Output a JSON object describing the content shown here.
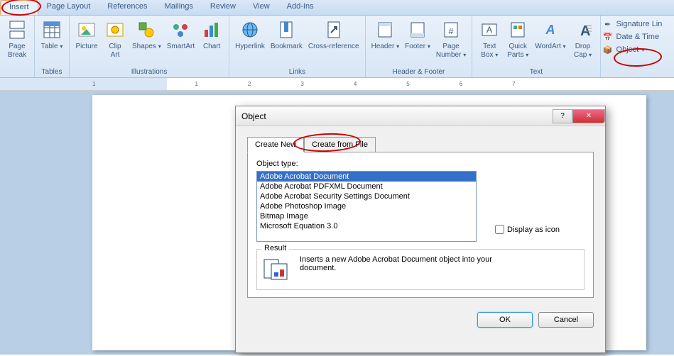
{
  "tabs": [
    "Insert",
    "Page Layout",
    "References",
    "Mailings",
    "Review",
    "View",
    "Add-Ins"
  ],
  "active_tab": "Insert",
  "ribbon": {
    "groups": [
      {
        "label": "",
        "items": [
          {
            "name": "page-break-button",
            "label": "Page\nBreak"
          }
        ]
      },
      {
        "label": "Tables",
        "items": [
          {
            "name": "table-button",
            "label": "Table",
            "dd": true
          }
        ]
      },
      {
        "label": "Illustrations",
        "items": [
          {
            "name": "picture-button",
            "label": "Picture"
          },
          {
            "name": "clipart-button",
            "label": "Clip\nArt"
          },
          {
            "name": "shapes-button",
            "label": "Shapes",
            "dd": true
          },
          {
            "name": "smartart-button",
            "label": "SmartArt"
          },
          {
            "name": "chart-button",
            "label": "Chart"
          }
        ]
      },
      {
        "label": "Links",
        "items": [
          {
            "name": "hyperlink-button",
            "label": "Hyperlink"
          },
          {
            "name": "bookmark-button",
            "label": "Bookmark"
          },
          {
            "name": "crossref-button",
            "label": "Cross-reference"
          }
        ]
      },
      {
        "label": "Header & Footer",
        "items": [
          {
            "name": "header-button",
            "label": "Header",
            "dd": true
          },
          {
            "name": "footer-button",
            "label": "Footer",
            "dd": true
          },
          {
            "name": "pagenum-button",
            "label": "Page\nNumber",
            "dd": true
          }
        ]
      },
      {
        "label": "Text",
        "items": [
          {
            "name": "textbox-button",
            "label": "Text\nBox",
            "dd": true
          },
          {
            "name": "quickparts-button",
            "label": "Quick\nParts",
            "dd": true
          },
          {
            "name": "wordart-button",
            "label": "WordArt",
            "dd": true
          },
          {
            "name": "dropcap-button",
            "label": "Drop\nCap",
            "dd": true
          }
        ]
      }
    ],
    "side_items": [
      {
        "name": "signature-line-button",
        "label": "Signature Lin"
      },
      {
        "name": "date-time-button",
        "label": "Date & Time"
      },
      {
        "name": "object-button",
        "label": "Object",
        "dd": true
      }
    ]
  },
  "ruler_marks": [
    "1",
    "",
    "1",
    "2",
    "3",
    "4",
    "5",
    "6",
    "7"
  ],
  "dialog": {
    "title": "Object",
    "tabs": [
      "Create New",
      "Create from File"
    ],
    "active_tab": 0,
    "object_type_label": "Object type:",
    "options": [
      "Adobe Acrobat Document",
      "Adobe Acrobat PDFXML Document",
      "Adobe Acrobat Security Settings Document",
      "Adobe Photoshop Image",
      "Bitmap Image",
      "Microsoft Equation 3.0"
    ],
    "selected_index": 0,
    "display_as_icon": "Display as icon",
    "result_title": "Result",
    "result_text": "Inserts a new Adobe Acrobat Document object into your document.",
    "ok": "OK",
    "cancel": "Cancel"
  }
}
